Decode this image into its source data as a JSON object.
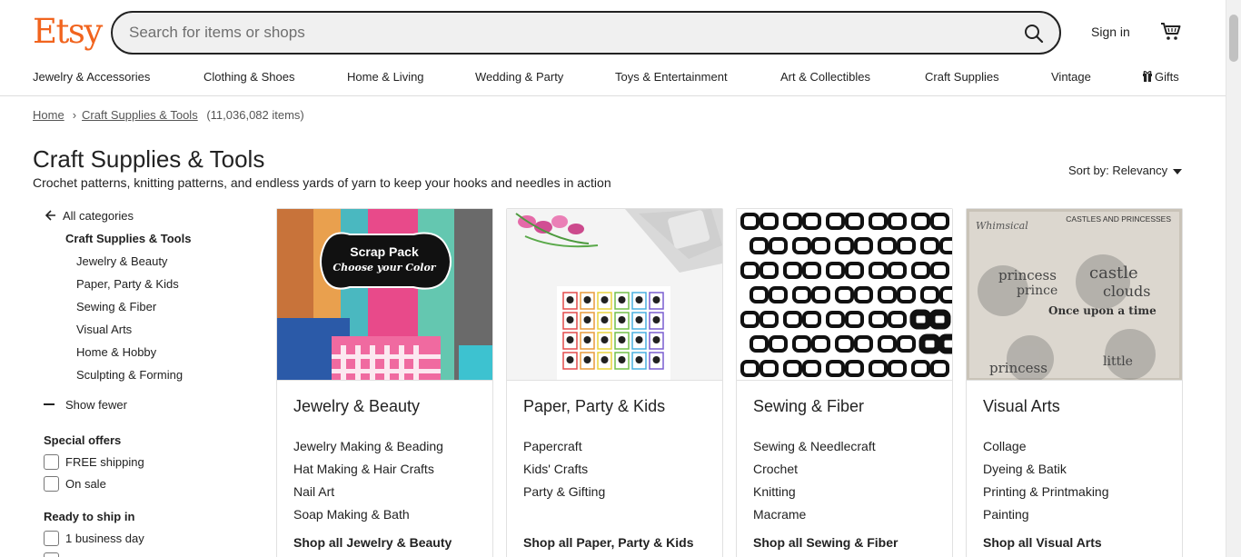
{
  "brand": {
    "logo": "Etsy",
    "color": "#f1641e"
  },
  "search": {
    "placeholder": "Search for items or shops",
    "icon": "search-icon"
  },
  "header": {
    "signin_label": "Sign in",
    "cart_icon": "cart-icon"
  },
  "categories": [
    "Jewelry & Accessories",
    "Clothing & Shoes",
    "Home & Living",
    "Wedding & Party",
    "Toys & Entertainment",
    "Art & Collectibles",
    "Craft Supplies",
    "Vintage",
    "Gifts"
  ],
  "breadcrumb": {
    "home": "Home",
    "current": "Craft Supplies & Tools",
    "count": "(11,036,082 items)"
  },
  "page": {
    "title": "Craft Supplies & Tools",
    "description": "Crochet patterns, knitting patterns, and endless yards of yarn to keep your hooks and needles in action",
    "sort_label": "Sort by: Relevancy"
  },
  "sidebar": {
    "all_categories": "All categories",
    "current": "Craft Supplies & Tools",
    "subcategories": [
      "Jewelry & Beauty",
      "Paper, Party & Kids",
      "Sewing & Fiber",
      "Visual Arts",
      "Home & Hobby",
      "Sculpting & Forming"
    ],
    "show_fewer": "Show fewer",
    "special_offers": {
      "title": "Special offers",
      "options": [
        "FREE shipping",
        "On sale"
      ]
    },
    "ready_to_ship": {
      "title": "Ready to ship in",
      "options": [
        "1 business day"
      ]
    }
  },
  "cards": [
    {
      "title": "Jewelry & Beauty",
      "links": [
        "Jewelry Making & Beading",
        "Hat Making & Hair Crafts",
        "Nail Art",
        "Soap Making & Bath"
      ],
      "shop_all": "Shop all Jewelry & Beauty",
      "image_text": [
        "Scrap Pack",
        "Choose your Color"
      ]
    },
    {
      "title": "Paper, Party & Kids",
      "links": [
        "Papercraft",
        "Kids' Crafts",
        "Party & Gifting"
      ],
      "shop_all": "Shop all Paper, Party & Kids"
    },
    {
      "title": "Sewing & Fiber",
      "links": [
        "Sewing & Needlecraft",
        "Crochet",
        "Knitting",
        "Macrame"
      ],
      "shop_all": "Shop all Sewing & Fiber"
    },
    {
      "title": "Visual Arts",
      "links": [
        "Collage",
        "Dyeing & Batik",
        "Printing & Printmaking",
        "Painting"
      ],
      "shop_all": "Shop all Visual Arts",
      "image_text": [
        "CASTLES AND PRINCESSES",
        "princess",
        "prince",
        "castle",
        "clouds",
        "Once upon a time",
        "little",
        "princess"
      ]
    }
  ]
}
